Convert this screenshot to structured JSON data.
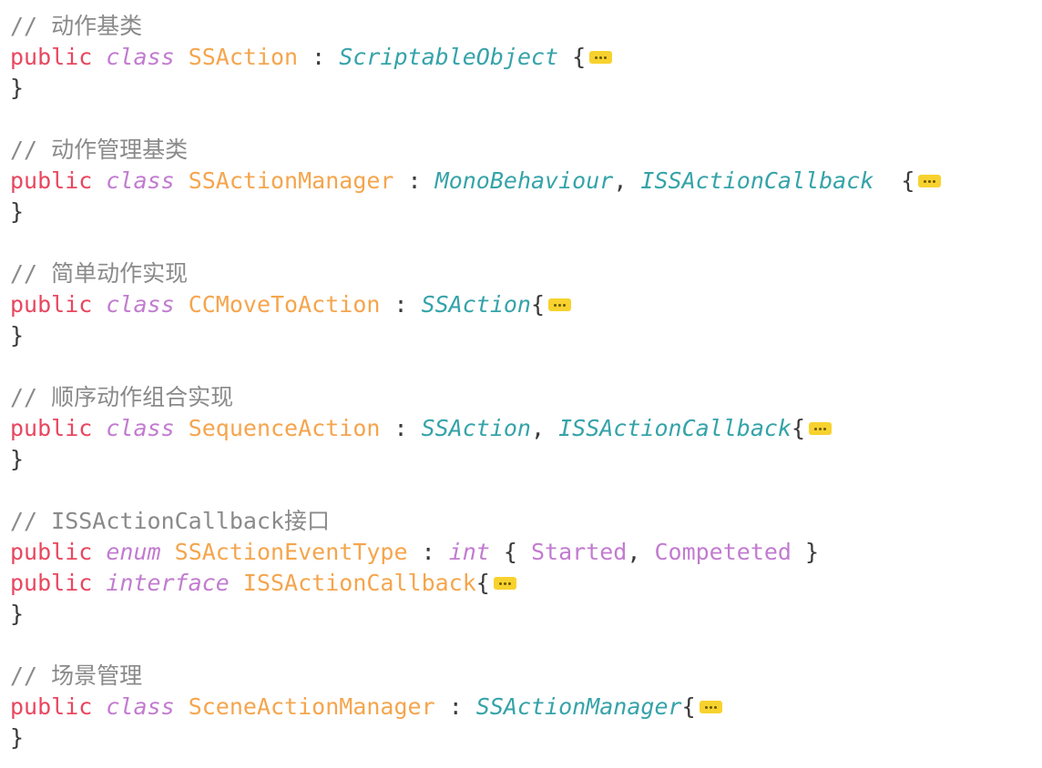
{
  "blocks": [
    {
      "comment": "// 动作基类",
      "decl": {
        "public": "public",
        "keyword": "class",
        "name": "SSAction",
        "sep": " : ",
        "bases": [
          {
            "text": "ScriptableObject",
            "kind": "base"
          },
          {
            "text": " {",
            "kind": "punc"
          }
        ]
      },
      "close": "}"
    },
    {
      "comment": "// 动作管理基类",
      "decl": {
        "public": "public",
        "keyword": "class",
        "name": "SSActionManager",
        "sep": " : ",
        "bases": [
          {
            "text": "MonoBehaviour",
            "kind": "base"
          },
          {
            "text": ", ",
            "kind": "punc"
          },
          {
            "text": "ISSActionCallback",
            "kind": "base"
          },
          {
            "text": "  {",
            "kind": "punc"
          }
        ]
      },
      "close": "}"
    },
    {
      "comment": "// 简单动作实现",
      "decl": {
        "public": "public",
        "keyword": "class",
        "name": "CCMoveToAction",
        "sep": " : ",
        "bases": [
          {
            "text": "SSAction",
            "kind": "base"
          },
          {
            "text": "{",
            "kind": "punc"
          }
        ]
      },
      "close": "}"
    },
    {
      "comment": "// 顺序动作组合实现",
      "decl": {
        "public": "public",
        "keyword": "class",
        "name": "SequenceAction",
        "sep": " : ",
        "bases": [
          {
            "text": "SSAction",
            "kind": "base"
          },
          {
            "text": ", ",
            "kind": "punc"
          },
          {
            "text": "ISSActionCallback",
            "kind": "base"
          },
          {
            "text": "{",
            "kind": "punc"
          }
        ]
      },
      "close": "}"
    },
    {
      "comment": "// ISSActionCallback接口",
      "enum_line": {
        "public": "public",
        "keyword": "enum",
        "name": "SSActionEventType",
        "sep": " : ",
        "underlying": "int",
        "open": " { ",
        "values": [
          "Started",
          "Competeted"
        ],
        "value_sep": ", ",
        "close": " }"
      },
      "decl": {
        "public": "public",
        "keyword": "interface",
        "name": "ISSActionCallback",
        "sep": "",
        "bases": [
          {
            "text": "{",
            "kind": "punc"
          }
        ]
      },
      "close": "}"
    },
    {
      "comment": "// 场景管理",
      "decl": {
        "public": "public",
        "keyword": "class",
        "name": "SceneActionManager",
        "sep": " : ",
        "bases": [
          {
            "text": "SSActionManager",
            "kind": "base"
          },
          {
            "text": "{",
            "kind": "punc"
          }
        ]
      },
      "close": "}"
    }
  ],
  "fold_marker": {
    "icon": "ellipsis-fold-icon",
    "color": "#f7d22e"
  },
  "colors": {
    "comment": "#8a8a8a",
    "public": "#e8475f",
    "keyword": "#c27bd0",
    "type_name": "#f5a54d",
    "base_type": "#35a3a9"
  }
}
